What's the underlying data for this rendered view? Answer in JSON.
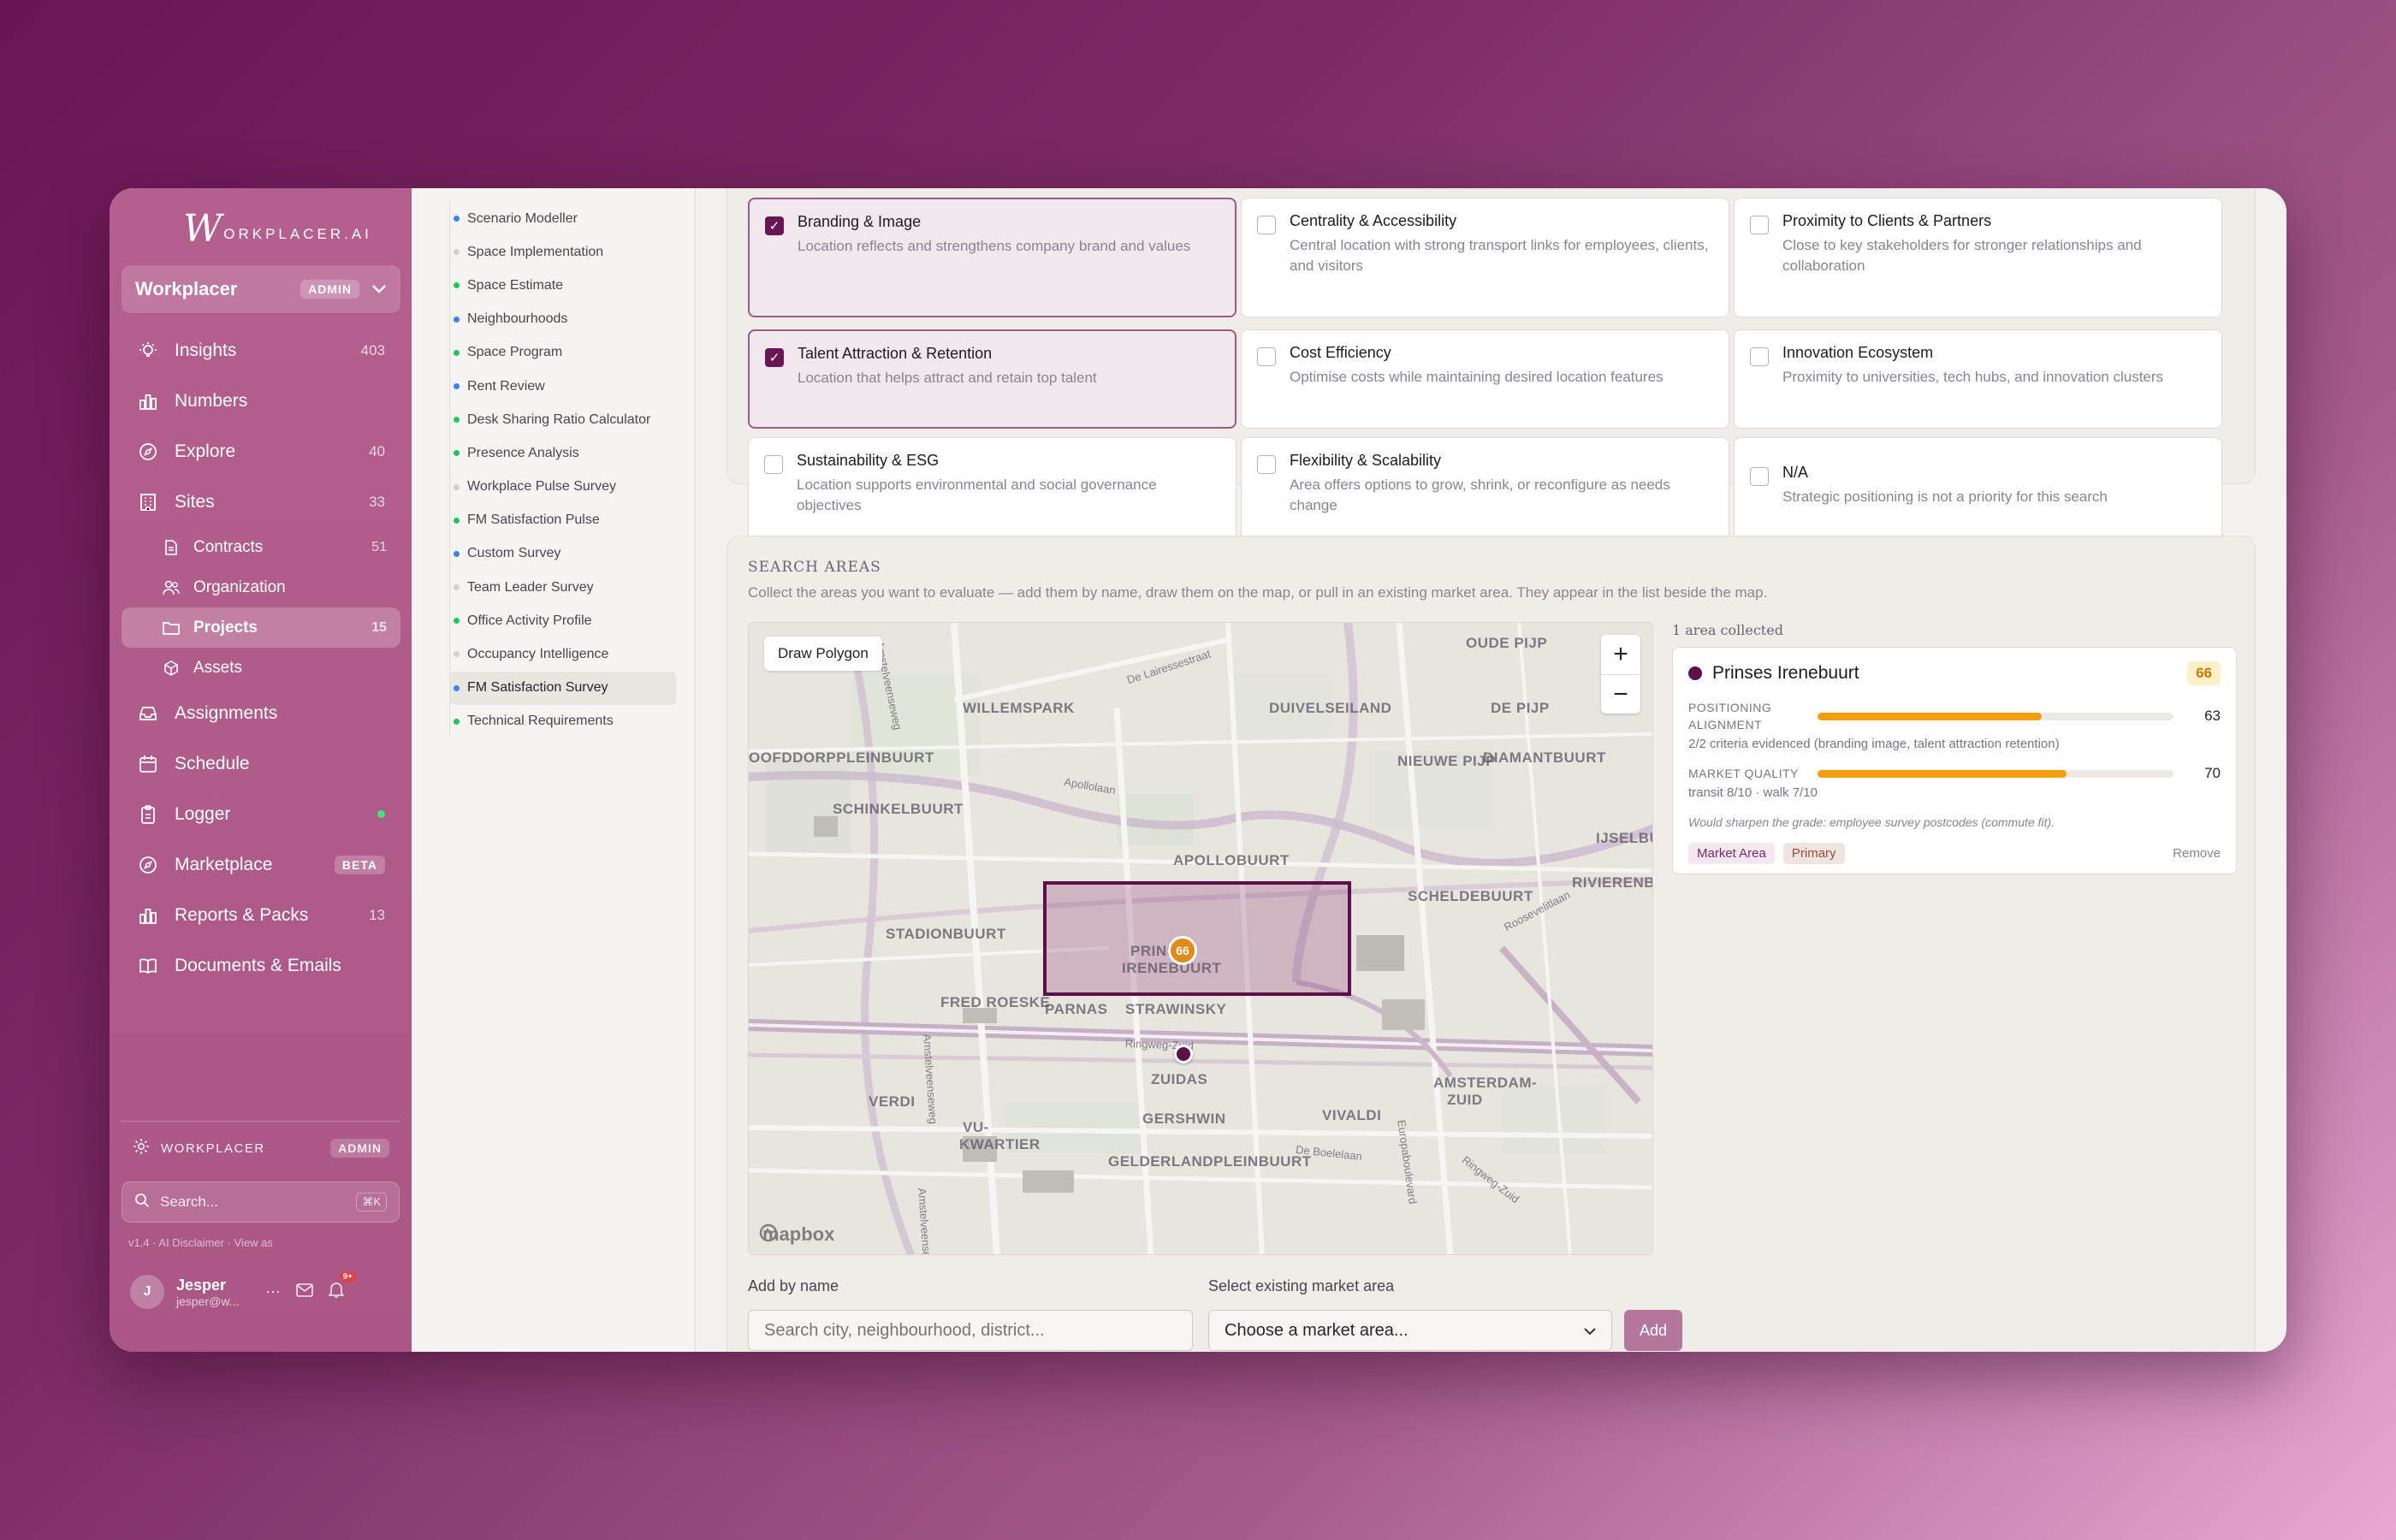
{
  "brand": {
    "w": "W",
    "text": "ORKPLACER.AI"
  },
  "org": {
    "name": "Workplacer",
    "badge": "ADMIN"
  },
  "nav": [
    {
      "label": "Insights",
      "count": "403"
    },
    {
      "label": "Numbers",
      "count": ""
    },
    {
      "label": "Explore",
      "count": "40"
    },
    {
      "label": "Sites",
      "count": "33"
    }
  ],
  "sites_sub": [
    {
      "label": "Contracts",
      "count": "51"
    },
    {
      "label": "Organization",
      "count": ""
    },
    {
      "label": "Projects",
      "count": "15"
    },
    {
      "label": "Assets",
      "count": ""
    }
  ],
  "nav2": [
    {
      "label": "Assignments"
    },
    {
      "label": "Schedule"
    },
    {
      "label": "Logger"
    },
    {
      "label": "Marketplace",
      "badge": "BETA"
    },
    {
      "label": "Reports & Packs",
      "count": "13"
    },
    {
      "label": "Documents & Emails"
    }
  ],
  "footer": {
    "workspace": "WORKPLACER",
    "workspace_badge": "ADMIN",
    "search_placeholder": "Search...",
    "shortcut": "⌘K",
    "version": "v1.4 · AI Disclaimer · View as",
    "user_initial": "J",
    "user_name": "Jesper",
    "user_email": "jesper@w...",
    "notif": "9+"
  },
  "tools": [
    {
      "label": "Scenario Modeller",
      "color": "#3b82f6"
    },
    {
      "label": "Space Implementation",
      "color": "#d4d0cc"
    },
    {
      "label": "Space Estimate",
      "color": "#22c55e"
    },
    {
      "label": "Neighbourhoods",
      "color": "#3b82f6"
    },
    {
      "label": "Space Program",
      "color": "#22c55e"
    },
    {
      "label": "Rent Review",
      "color": "#3b82f6"
    },
    {
      "label": "Desk Sharing Ratio Calculator",
      "color": "#22c55e"
    },
    {
      "label": "Presence Analysis",
      "color": "#22c55e"
    },
    {
      "label": "Workplace Pulse Survey",
      "color": "#d4d0cc"
    },
    {
      "label": "FM Satisfaction Pulse",
      "color": "#22c55e"
    },
    {
      "label": "Custom Survey",
      "color": "#3b82f6"
    },
    {
      "label": "Team Leader Survey",
      "color": "#d4d0cc"
    },
    {
      "label": "Office Activity Profile",
      "color": "#22c55e"
    },
    {
      "label": "Occupancy Intelligence",
      "color": "#d4d0cc"
    },
    {
      "label": "FM Satisfaction Survey",
      "color": "#3b82f6"
    },
    {
      "label": "Technical Requirements",
      "color": "#22c55e"
    }
  ],
  "criteria": [
    {
      "title": "Branding & Image",
      "desc": "Location reflects and strengthens company brand and values",
      "checked": true
    },
    {
      "title": "Centrality & Accessibility",
      "desc": "Central location with strong transport links for employees, clients, and visitors",
      "checked": false
    },
    {
      "title": "Proximity to Clients & Partners",
      "desc": "Close to key stakeholders for stronger relationships and collaboration",
      "checked": false
    },
    {
      "title": "Talent Attraction & Retention",
      "desc": "Location that helps attract and retain top talent",
      "checked": true
    },
    {
      "title": "Cost Efficiency",
      "desc": "Optimise costs while maintaining desired location features",
      "checked": false
    },
    {
      "title": "Innovation Ecosystem",
      "desc": "Proximity to universities, tech hubs, and innovation clusters",
      "checked": false
    },
    {
      "title": "Sustainability & ESG",
      "desc": "Location supports environmental and social governance objectives",
      "checked": false
    },
    {
      "title": "Flexibility & Scalability",
      "desc": "Area offers options to grow, shrink, or reconfigure as needs change",
      "checked": false
    },
    {
      "title": "N/A",
      "desc": "Strategic positioning is not a priority for this search",
      "checked": false
    }
  ],
  "search_areas": {
    "title": "SEARCH AREAS",
    "desc": "Collect the areas you want to evaluate — add them by name, draw them on the map, or pull in an existing market area. They appear in the list beside the map.",
    "draw_btn": "Draw Polygon",
    "zoom_in": "+",
    "zoom_out": "−",
    "attribution": "mapbox",
    "marker_score": "66",
    "map_labels": [
      "OUDE PIJP",
      "WILLEMSPARK",
      "DUIVELSEILAND",
      "DE PIJP",
      "OOFDDORPPLEINBUURT",
      "NIEUWE PIJP",
      "DIAMANTBUURT",
      "SCHINKELBUURT",
      "IJSELBU",
      "APOLLOBUURT",
      "SCHELDEBUURT",
      "RIVIERENBUURT",
      "STADIONBUURT",
      "PRINSES",
      "IRENEBUURT",
      "FRED ROESKE",
      "PARNAS",
      "STRAWINSKY",
      "ZUIDAS",
      "AMSTERDAM-",
      "ZUID",
      "VERDI",
      "GERSHWIN",
      "VIVALDI",
      "VU-",
      "KWARTIER",
      "GELDERLANDPLEINBUURT"
    ],
    "street_labels": [
      "De Lairessestraat",
      "Apollolaan",
      "Amstelveenseweg",
      "Roosevelitlaan",
      "Ringweg-Zuid",
      "De Boelelaan",
      "Europaboulevard",
      "Ringweg-Zuid",
      "Amstelveenseweg",
      "Amstelveenseweg"
    ],
    "collected": "1 area collected",
    "area": {
      "name": "Prinses Irenebuurt",
      "score": "66",
      "pos_label": "POSITIONING ALIGNMENT",
      "pos_value": "63",
      "pos_note": "2/2 criteria evidenced (branding image, talent attraction retention)",
      "mq_label": "MARKET QUALITY",
      "mq_value": "70",
      "mq_note": "transit 8/10 · walk 7/10",
      "hint": "Would sharpen the grade: employee survey postcodes (commute fit).",
      "tag1": "Market Area",
      "tag2": "Primary",
      "remove": "Remove"
    },
    "add_by_name_label": "Add by name",
    "add_by_name_placeholder": "Search city, neighbourhood, district...",
    "market_label": "Select existing market area",
    "market_placeholder": "Choose a market area...",
    "add_btn": "Add"
  }
}
